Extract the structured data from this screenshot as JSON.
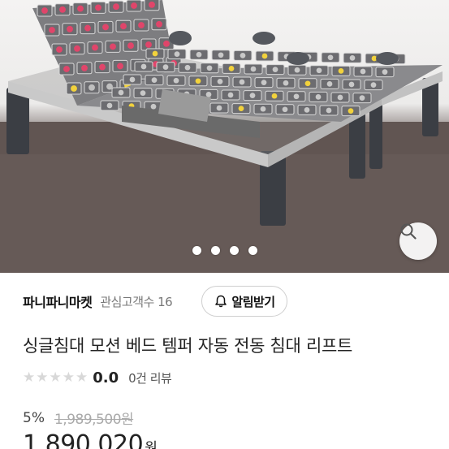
{
  "image": {
    "subject": "electric-adjustable-bed-frame-photo",
    "slide_count": 4
  },
  "seller": {
    "name": "파니파니마켓",
    "follower_text": "관심고객수 16",
    "follow_label": "알림받기"
  },
  "product": {
    "title": "싱글침대 모션 베드 템퍼 자동 전동 침대 리프트",
    "rating": 0,
    "rating_text": "0.0",
    "review_text": "0건 리뷰",
    "discount": "5%",
    "original_price": "1,989,500원",
    "price": "1,890,020",
    "currency": "원"
  },
  "icons": {
    "zoom": "search-icon",
    "bell": "bell-plus-icon",
    "star": "star-icon"
  },
  "colors": {
    "star_empty": "#d8d8d8",
    "accent_red": "#e0456a",
    "accent_yellow": "#f2d23c"
  }
}
